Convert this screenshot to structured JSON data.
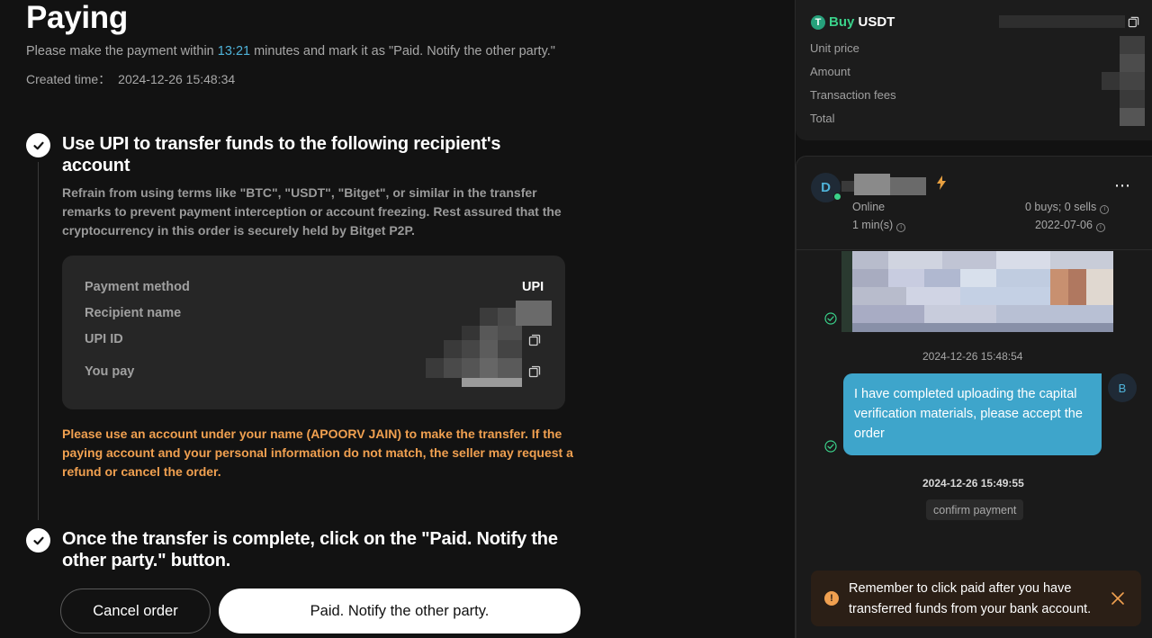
{
  "header": {
    "title": "Paying",
    "instruction_prefix": "Please make the payment within ",
    "timer": "13:21",
    "instruction_suffix": " minutes and mark it as \"Paid. Notify the other party.\"",
    "created_label": "Created time：",
    "created_value": "2024-12-26 15:48:34"
  },
  "step1": {
    "title": "Use UPI to transfer funds to the following recipient's account",
    "warning": "Refrain from using terms like \"BTC\", \"USDT\", \"Bitget\", or similar in the transfer remarks to prevent payment interception or account freezing. Rest assured that the cryptocurrency in this order is securely held by Bitget P2P.",
    "payment_method_label": "Payment method",
    "payment_method_value": "UPI",
    "recipient_label": "Recipient name",
    "upi_id_label": "UPI ID",
    "you_pay_label": "You pay",
    "note": "Please use an account under your name (APOORV JAIN) to make the transfer. If the paying account and your personal information do not match, the seller may request a refund or cancel the order."
  },
  "step2": {
    "title": "Once the transfer is complete, click on the \"Paid. Notify the other party.\" button."
  },
  "buttons": {
    "cancel": "Cancel order",
    "paid": "Paid. Notify the other party."
  },
  "order": {
    "buy_word": "Buy",
    "asset": "USDT",
    "tether_glyph": "T",
    "unit_price_label": "Unit price",
    "amount_label": "Amount",
    "fees_label": "Transaction fees",
    "total_label": "Total"
  },
  "chat": {
    "avatar_letter": "D",
    "status": "Online",
    "response_time": "1 min(s)",
    "trades": "0 buys; 0 sells",
    "joined": "2022-07-06",
    "more": "⋯",
    "timestamp_1": "2024-12-26 15:48:54",
    "message": "I have completed uploading the capital verification materials, please accept the order",
    "my_avatar_letter": "B",
    "timestamp_2": "2024-12-26 15:49:55",
    "system_chip": "confirm payment"
  },
  "toast": {
    "icon": "!",
    "message": "Remember to click paid after you have transferred funds from your bank account."
  },
  "colors": {
    "accent_blue": "#4fb3d9",
    "buy_green": "#3ad18a",
    "warning_orange": "#f0a050",
    "bubble_blue": "#3ea5cb"
  }
}
